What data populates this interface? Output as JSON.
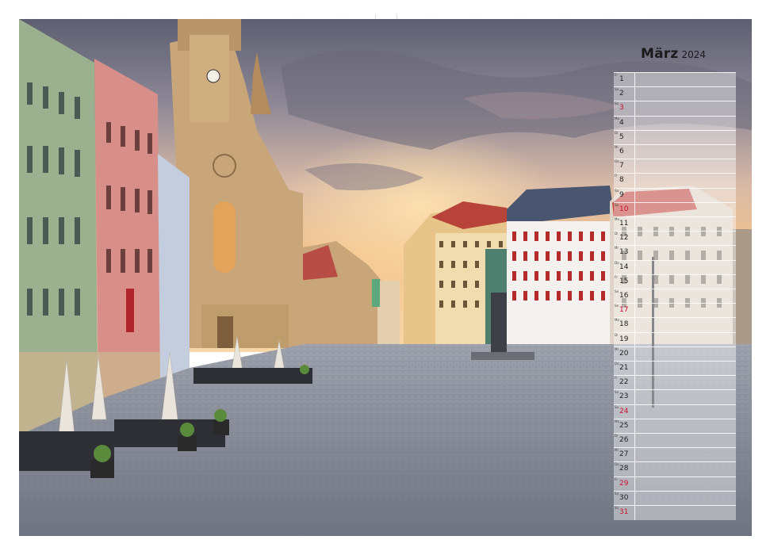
{
  "calendar": {
    "month": "März",
    "year": "2024",
    "days": [
      {
        "day": "1",
        "wd": "Fr",
        "sunday": false
      },
      {
        "day": "2",
        "wd": "Sa",
        "sunday": false
      },
      {
        "day": "3",
        "wd": "So",
        "sunday": true
      },
      {
        "day": "4",
        "wd": "Mo",
        "sunday": false
      },
      {
        "day": "5",
        "wd": "Di",
        "sunday": false
      },
      {
        "day": "6",
        "wd": "Mi",
        "sunday": false
      },
      {
        "day": "7",
        "wd": "Do",
        "sunday": false
      },
      {
        "day": "8",
        "wd": "Fr",
        "sunday": false
      },
      {
        "day": "9",
        "wd": "Sa",
        "sunday": false
      },
      {
        "day": "10",
        "wd": "So",
        "sunday": true
      },
      {
        "day": "11",
        "wd": "Mo",
        "sunday": false
      },
      {
        "day": "12",
        "wd": "Di",
        "sunday": false
      },
      {
        "day": "13",
        "wd": "Mi",
        "sunday": false
      },
      {
        "day": "14",
        "wd": "Do",
        "sunday": false
      },
      {
        "day": "15",
        "wd": "Fr",
        "sunday": false
      },
      {
        "day": "16",
        "wd": "Sa",
        "sunday": false
      },
      {
        "day": "17",
        "wd": "So",
        "sunday": true
      },
      {
        "day": "18",
        "wd": "Mo",
        "sunday": false
      },
      {
        "day": "19",
        "wd": "Di",
        "sunday": false
      },
      {
        "day": "20",
        "wd": "Mi",
        "sunday": false
      },
      {
        "day": "21",
        "wd": "Do",
        "sunday": false
      },
      {
        "day": "22",
        "wd": "Fr",
        "sunday": false
      },
      {
        "day": "23",
        "wd": "Sa",
        "sunday": false
      },
      {
        "day": "24",
        "wd": "So",
        "sunday": true
      },
      {
        "day": "25",
        "wd": "Mo",
        "sunday": false
      },
      {
        "day": "26",
        "wd": "Di",
        "sunday": false
      },
      {
        "day": "27",
        "wd": "Mi",
        "sunday": false
      },
      {
        "day": "28",
        "wd": "Do",
        "sunday": false
      },
      {
        "day": "29",
        "wd": "Fr",
        "sunday": true
      },
      {
        "day": "30",
        "wd": "Sa",
        "sunday": false
      },
      {
        "day": "31",
        "wd": "So",
        "sunday": true
      }
    ]
  },
  "colors": {
    "holiday_red": "#c8102e",
    "cobblestone": "#8a8e98",
    "sky_warm": "#f2c189"
  }
}
